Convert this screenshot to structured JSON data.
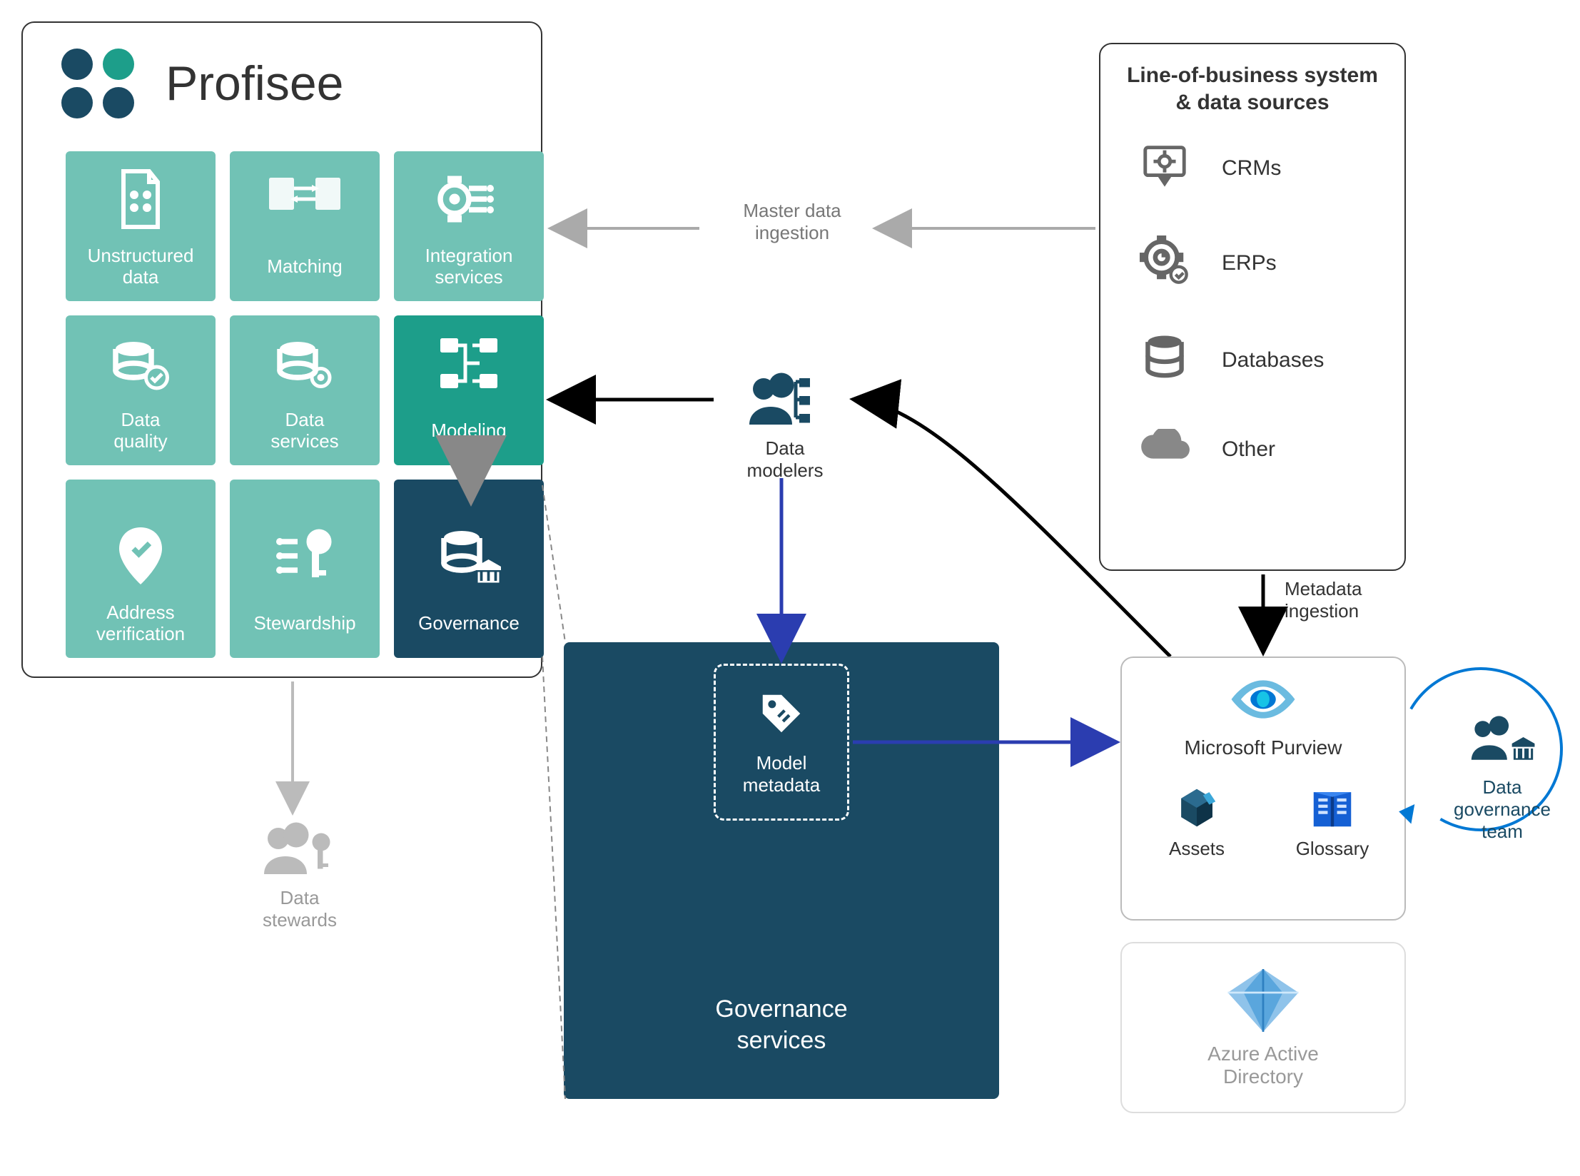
{
  "profisee": {
    "title": "Profisee",
    "tiles": {
      "unstructured": "Unstructured\ndata",
      "matching": "Matching",
      "integration": "Integration\nservices",
      "quality": "Data\nquality",
      "dataservices": "Data\nservices",
      "modeling": "Modeling",
      "address": "Address\nverification",
      "stewardship": "Stewardship",
      "governance": "Governance"
    }
  },
  "actors": {
    "modelers": "Data\nmodelers",
    "stewards": "Data\nstewards",
    "govteam": "Data\ngovernance\nteam"
  },
  "governance": {
    "metadata": "Model\nmetadata",
    "title": "Governance\nservices"
  },
  "lob": {
    "title": "Line-of-business system\n& data sources",
    "items": {
      "crms": "CRMs",
      "erps": "ERPs",
      "databases": "Databases",
      "other": "Other"
    }
  },
  "flow": {
    "master_ingestion": "Master data\ningestion",
    "metadata_ingestion": "Metadata\ningestion"
  },
  "purview": {
    "title": "Microsoft Purview",
    "assets": "Assets",
    "glossary": "Glossary"
  },
  "aad": {
    "title": "Azure Active\nDirectory"
  }
}
